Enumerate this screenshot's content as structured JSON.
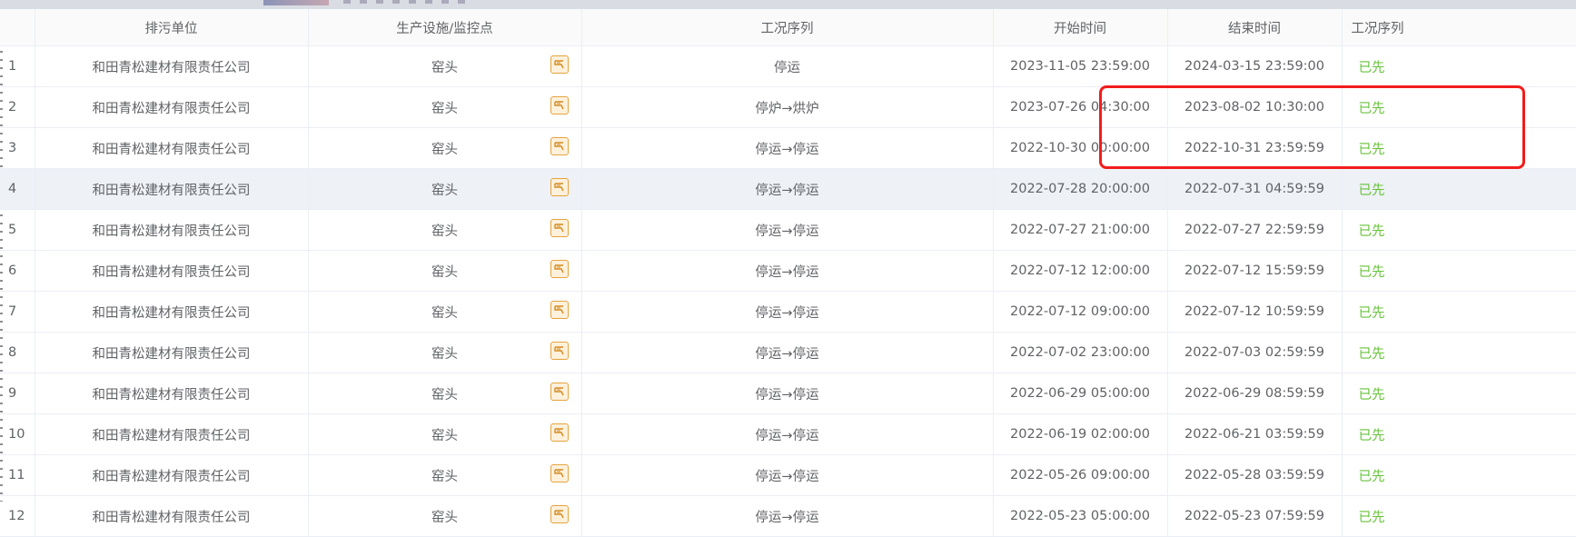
{
  "columns": {
    "index": "",
    "unit": "排污单位",
    "facility": "生产设施/监控点",
    "sequence": "工况序列",
    "start": "开始时间",
    "end": "结束时间",
    "status": "工况序列"
  },
  "rows": [
    {
      "index": "1",
      "unit": "和田青松建材有限责任公司",
      "facility": "窑头",
      "sequence": "停运",
      "start": "2023-11-05 23:59:00",
      "end": "2024-03-15 23:59:00",
      "status": "已先"
    },
    {
      "index": "2",
      "unit": "和田青松建材有限责任公司",
      "facility": "窑头",
      "sequence": "停炉→烘炉",
      "start": "2023-07-26 04:30:00",
      "end": "2023-08-02 10:30:00",
      "status": "已先"
    },
    {
      "index": "3",
      "unit": "和田青松建材有限责任公司",
      "facility": "窑头",
      "sequence": "停运→停运",
      "start": "2022-10-30 00:00:00",
      "end": "2022-10-31 23:59:59",
      "status": "已先"
    },
    {
      "index": "4",
      "unit": "和田青松建材有限责任公司",
      "facility": "窑头",
      "sequence": "停运→停运",
      "start": "2022-07-28 20:00:00",
      "end": "2022-07-31 04:59:59",
      "status": "已先"
    },
    {
      "index": "5",
      "unit": "和田青松建材有限责任公司",
      "facility": "窑头",
      "sequence": "停运→停运",
      "start": "2022-07-27 21:00:00",
      "end": "2022-07-27 22:59:59",
      "status": "已先"
    },
    {
      "index": "6",
      "unit": "和田青松建材有限责任公司",
      "facility": "窑头",
      "sequence": "停运→停运",
      "start": "2022-07-12 12:00:00",
      "end": "2022-07-12 15:59:59",
      "status": "已先"
    },
    {
      "index": "7",
      "unit": "和田青松建材有限责任公司",
      "facility": "窑头",
      "sequence": "停运→停运",
      "start": "2022-07-12 09:00:00",
      "end": "2022-07-12 10:59:59",
      "status": "已先"
    },
    {
      "index": "8",
      "unit": "和田青松建材有限责任公司",
      "facility": "窑头",
      "sequence": "停运→停运",
      "start": "2022-07-02 23:00:00",
      "end": "2022-07-03 02:59:59",
      "status": "已先"
    },
    {
      "index": "9",
      "unit": "和田青松建材有限责任公司",
      "facility": "窑头",
      "sequence": "停运→停运",
      "start": "2022-06-29 05:00:00",
      "end": "2022-06-29 08:59:59",
      "status": "已先"
    },
    {
      "index": "10",
      "unit": "和田青松建材有限责任公司",
      "facility": "窑头",
      "sequence": "停运→停运",
      "start": "2022-06-19 02:00:00",
      "end": "2022-06-21 03:59:59",
      "status": "已先"
    },
    {
      "index": "11",
      "unit": "和田青松建材有限责任公司",
      "facility": "窑头",
      "sequence": "停运→停运",
      "start": "2022-05-26 09:00:00",
      "end": "2022-05-28 03:59:59",
      "status": "已先"
    },
    {
      "index": "12",
      "unit": "和田青松建材有限责任公司",
      "facility": "窑头",
      "sequence": "停运→停运",
      "start": "2022-05-23 05:00:00",
      "end": "2022-05-23 07:59:59",
      "status": "已先"
    }
  ],
  "highlighted_row": "4",
  "colors": {
    "accent_box": "#f21c1c",
    "status_green": "#67c23a",
    "icon_orange": "#e6a23c"
  },
  "icons": {
    "facility": "monitor-flag-icon"
  }
}
